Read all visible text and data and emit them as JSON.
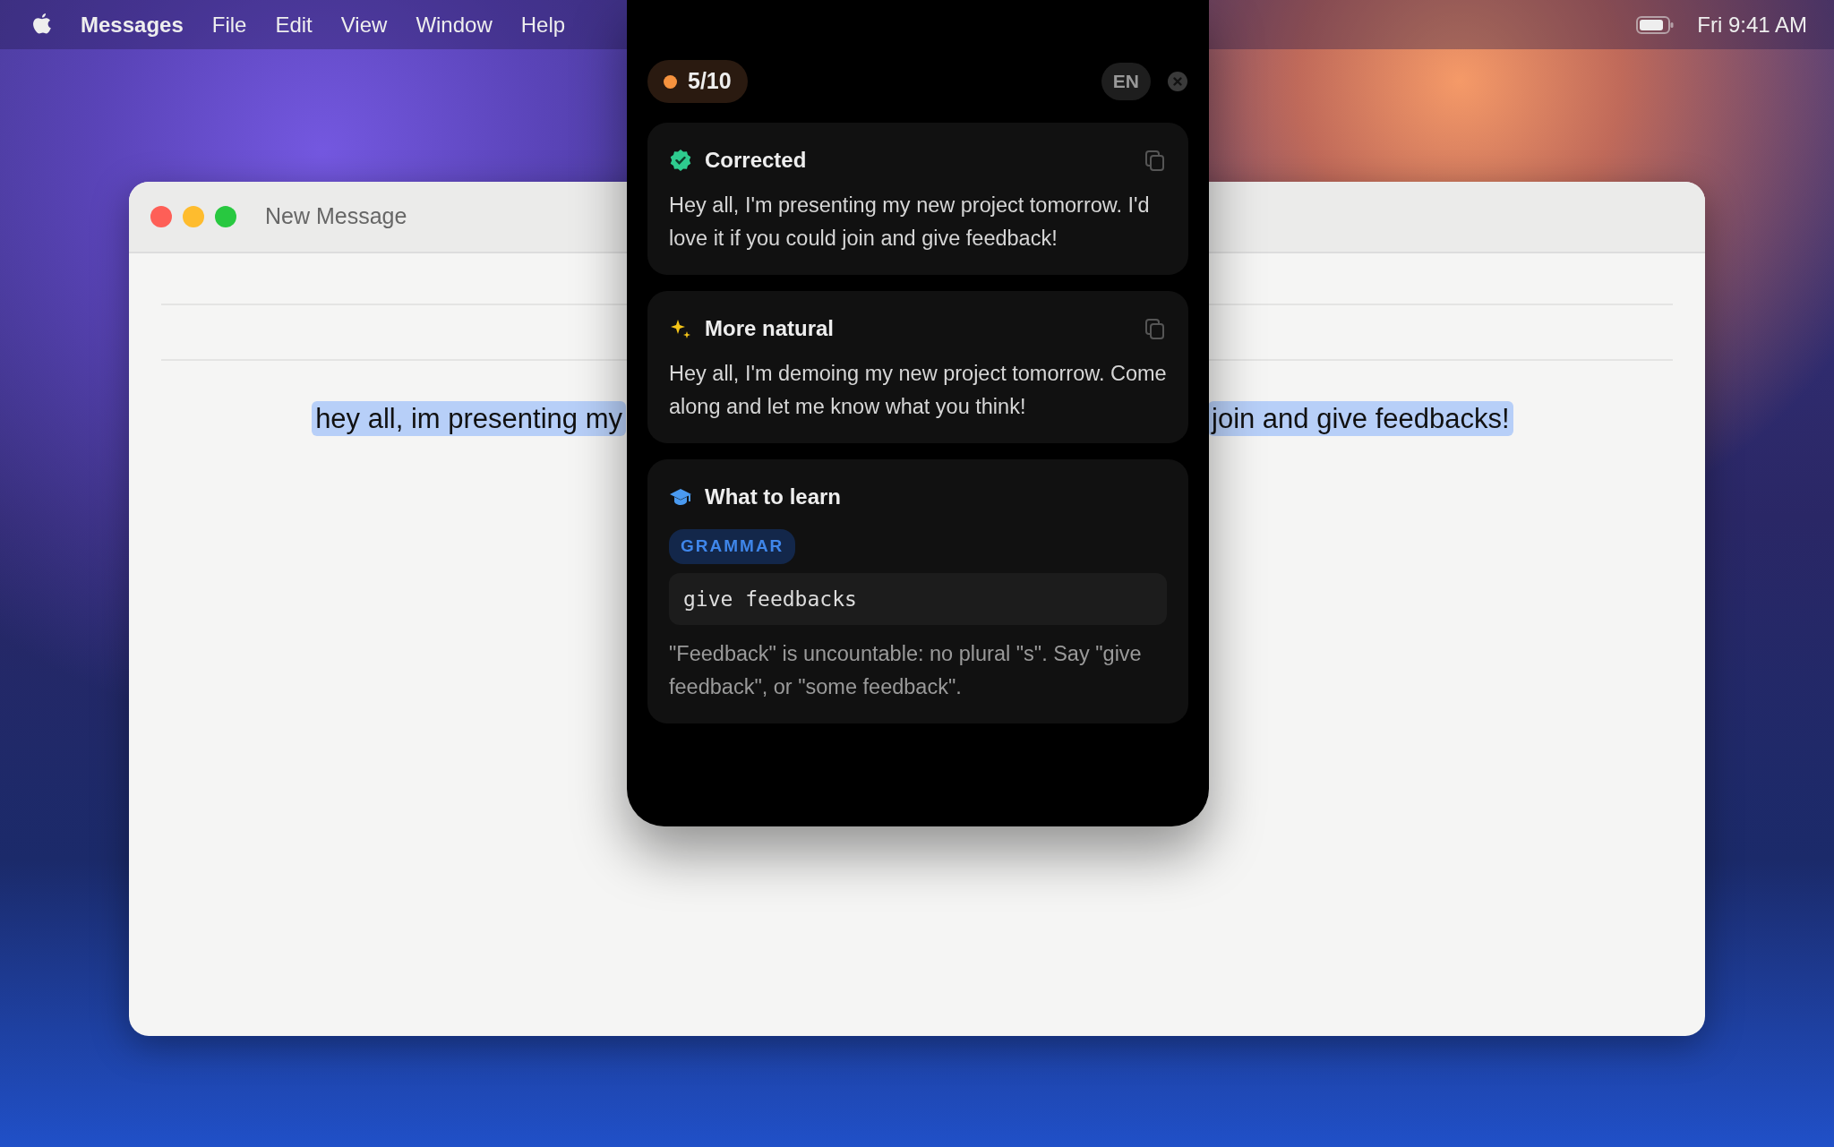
{
  "menu_bar": {
    "app": "Messages",
    "menus": [
      "File",
      "Edit",
      "View",
      "Window",
      "Help"
    ],
    "clock": "Fri 9:41 AM"
  },
  "window": {
    "title": "New Message",
    "selected": true,
    "message_parts": [
      "hey all, im presenting my",
      "join and give feedbacks!"
    ]
  },
  "popup": {
    "score": {
      "text": "5/10",
      "color": "#f5923e"
    },
    "language": "EN",
    "sections": [
      {
        "kind": "corrected",
        "title": "Corrected",
        "text": "Hey all, I'm presenting my new project tomorrow. I'd love it if you could join and give feedback!"
      },
      {
        "kind": "natural",
        "title": "More natural",
        "text": "Hey all, I'm demoing my new project tomorrow. Come along and let me know what you think!"
      },
      {
        "kind": "learn",
        "title": "What to learn",
        "tag": "GRAMMAR",
        "snippet": "give feedbacks",
        "explanation": "\"Feedback\" is uncountable: no plural \"s\". Say \"give feedback\", or \"some feedback\"."
      }
    ]
  }
}
